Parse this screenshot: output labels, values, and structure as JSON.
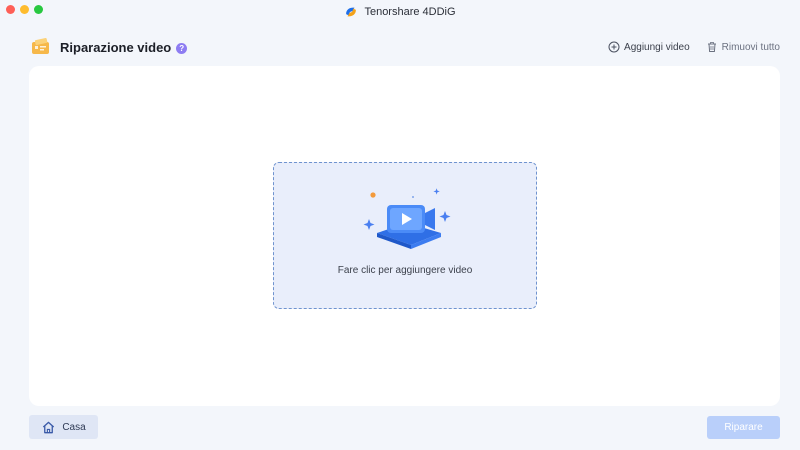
{
  "window": {
    "title": "Tenorshare 4DDiG",
    "logo_icon": "4ddig-logo-icon"
  },
  "header": {
    "title": "Riparazione video",
    "help_badge": "?",
    "add_label": "Aggiungi video",
    "remove_label": "Rimuovi tutto"
  },
  "dropzone": {
    "label": "Fare clic per aggiungere video",
    "illustration_icon": "video-camera-icon"
  },
  "footer": {
    "home_label": "Casa",
    "repair_label": "Riparare",
    "repair_enabled": false
  },
  "colors": {
    "accent": "#4a7ff0",
    "repair_disabled": "#b9cffa",
    "dropzone_border": "#6f93cf",
    "help_badge": "#8d7cf2"
  }
}
